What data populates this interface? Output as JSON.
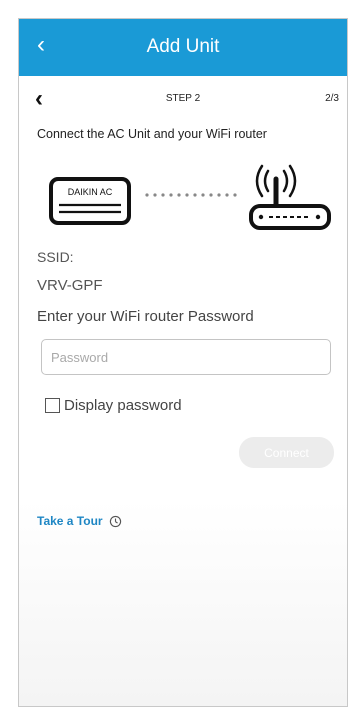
{
  "header": {
    "back_icon": "chevron-left-icon",
    "title": "Add Unit",
    "background": "#1a9ad6"
  },
  "step": {
    "label": "STEP 2",
    "counter": "2/3"
  },
  "instruction": "Connect the AC Unit and your WiFi router",
  "diagram": {
    "unit_label": "DAIKIN AC",
    "router_icon": "wifi-router-icon"
  },
  "ssid": {
    "label": "SSID:",
    "value": "VRV-GPF"
  },
  "password": {
    "label": "Enter your WiFi router Password",
    "placeholder": "Password",
    "value": ""
  },
  "display_password": {
    "label": "Display password",
    "checked": false
  },
  "connect": {
    "label": "Connect",
    "enabled": false
  },
  "tour": {
    "label": "Take a Tour",
    "icon": "clock-info-icon",
    "color": "#1e86c4"
  }
}
